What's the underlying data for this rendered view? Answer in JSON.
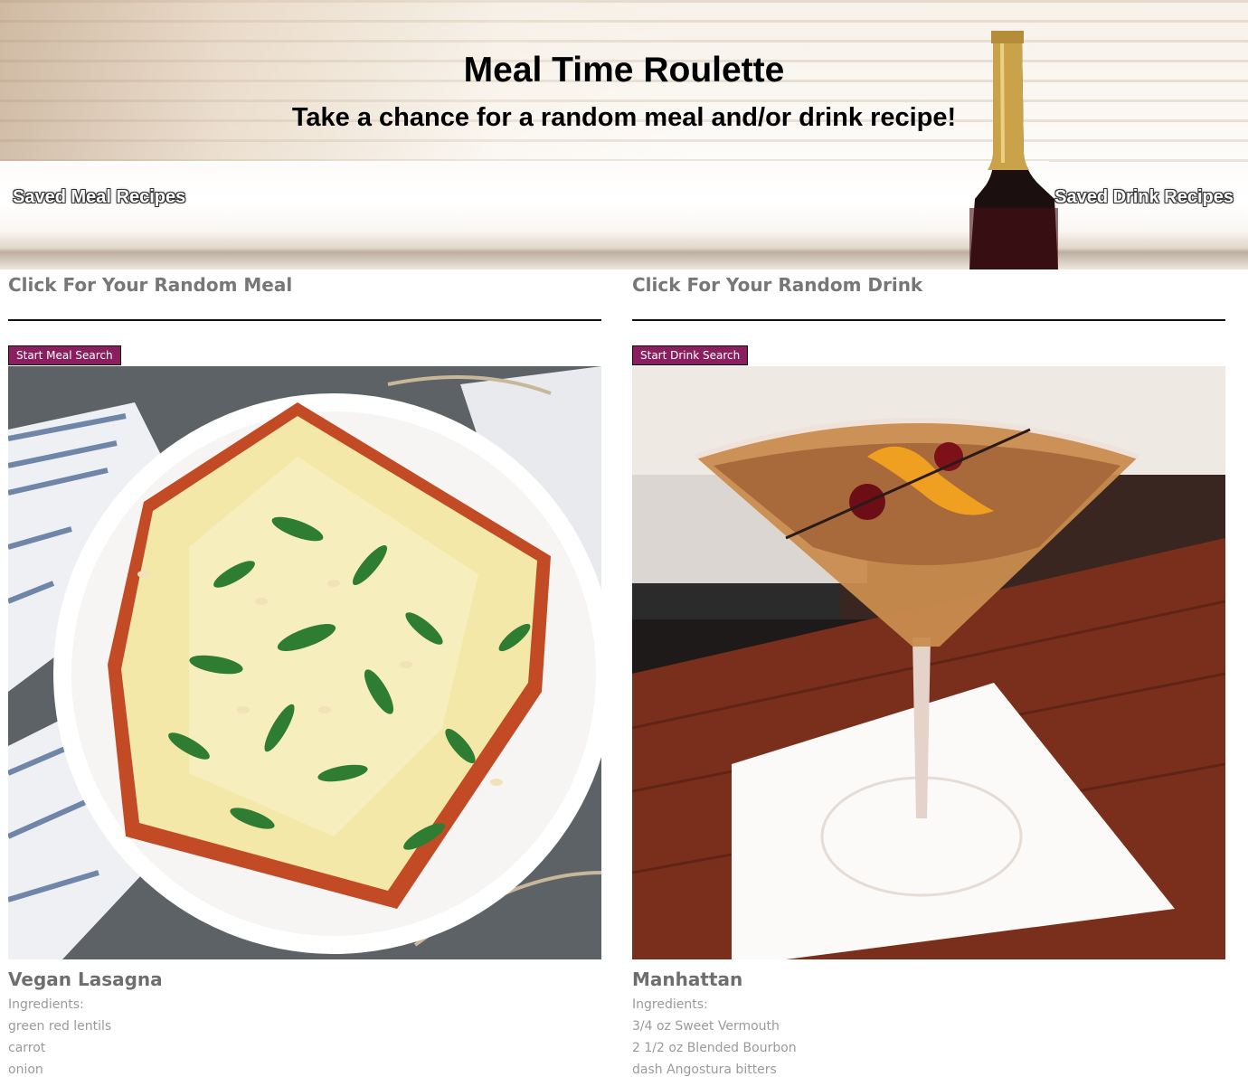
{
  "header": {
    "title": "Meal Time Roulette",
    "subtitle": "Take a chance for a random meal and/or drink recipe!",
    "saved_meal_label": "Saved Meal Recipes",
    "saved_drink_label": "Saved Drink Recipes"
  },
  "meal": {
    "heading": "Click For Your Random Meal",
    "button_label": "Start Meal Search",
    "name": "Vegan Lasagna",
    "ingredients_label": "Ingredients:",
    "ingredients": [
      "green red lentils",
      "carrot",
      "onion"
    ]
  },
  "drink": {
    "heading": "Click For Your Random Drink",
    "button_label": "Start Drink Search",
    "name": "Manhattan",
    "ingredients_label": "Ingredients:",
    "ingredients": [
      "3/4 oz Sweet Vermouth",
      "2 1/2 oz Blended Bourbon",
      "dash Angostura bitters"
    ]
  },
  "colors": {
    "button_bg": "#8a1e5e",
    "heading_text": "#777777",
    "ingredient_text": "#9a9a9a"
  }
}
